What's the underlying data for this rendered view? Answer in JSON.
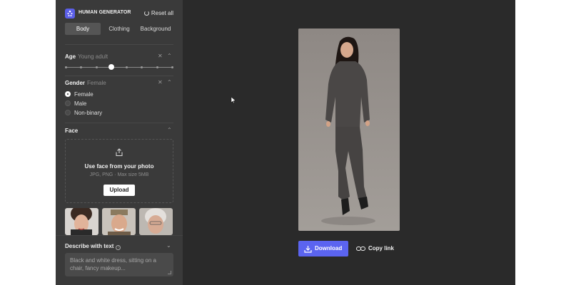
{
  "app": {
    "brand": "HUMAN GENERATOR",
    "reset_label": "Reset all",
    "accent": "#5b64f0"
  },
  "tabs": [
    {
      "label": "Body",
      "active": true
    },
    {
      "label": "Clothing",
      "active": false
    },
    {
      "label": "Background",
      "active": false
    }
  ],
  "age": {
    "title": "Age",
    "value": "Young adult",
    "steps": 8,
    "selected_step": 3
  },
  "gender": {
    "title": "Gender",
    "value": "Female",
    "options": [
      {
        "label": "Female",
        "selected": true
      },
      {
        "label": "Male",
        "selected": false
      },
      {
        "label": "Non-binary",
        "selected": false
      }
    ]
  },
  "face": {
    "title": "Face",
    "upload_title": "Use face from your photo",
    "upload_sub": "JPG, PNG · Max size 5MB",
    "upload_button": "Upload"
  },
  "describe": {
    "title": "Describe with text",
    "placeholder": "Black and white dress, sitting on a chair, fancy makeup..."
  },
  "actions": {
    "download_label": "Download",
    "copy_link_label": "Copy link"
  }
}
